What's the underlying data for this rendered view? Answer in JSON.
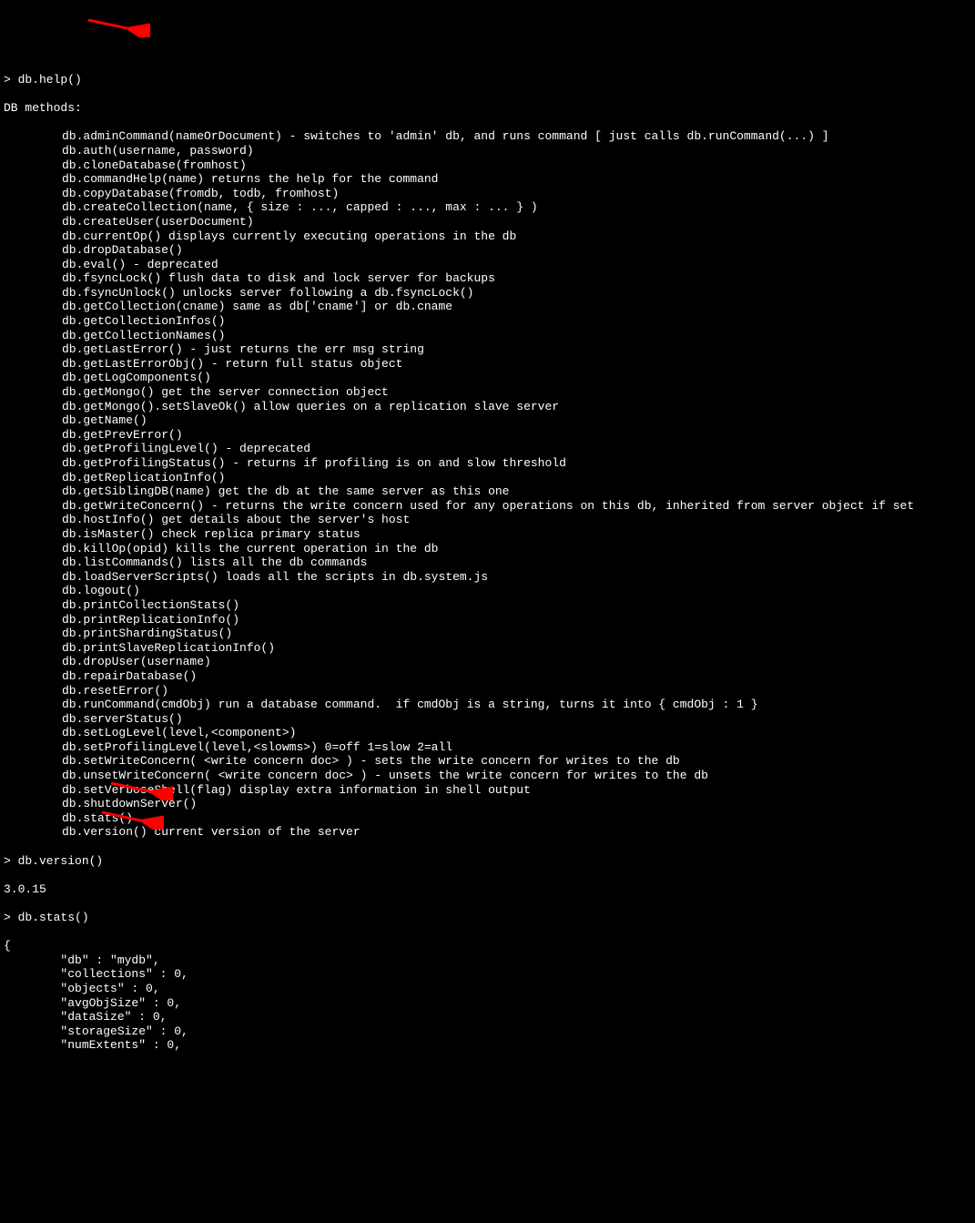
{
  "prompts": {
    "help": "> db.help()",
    "version": "> db.version()",
    "stats": "> db.stats()"
  },
  "header": "DB methods:",
  "methods": [
    "db.adminCommand(nameOrDocument) - switches to 'admin' db, and runs command [ just calls db.runCommand(...) ]",
    "db.auth(username, password)",
    "db.cloneDatabase(fromhost)",
    "db.commandHelp(name) returns the help for the command",
    "db.copyDatabase(fromdb, todb, fromhost)",
    "db.createCollection(name, { size : ..., capped : ..., max : ... } )",
    "db.createUser(userDocument)",
    "db.currentOp() displays currently executing operations in the db",
    "db.dropDatabase()",
    "db.eval() - deprecated",
    "db.fsyncLock() flush data to disk and lock server for backups",
    "db.fsyncUnlock() unlocks server following a db.fsyncLock()",
    "db.getCollection(cname) same as db['cname'] or db.cname",
    "db.getCollectionInfos()",
    "db.getCollectionNames()",
    "db.getLastError() - just returns the err msg string",
    "db.getLastErrorObj() - return full status object",
    "db.getLogComponents()",
    "db.getMongo() get the server connection object",
    "db.getMongo().setSlaveOk() allow queries on a replication slave server",
    "db.getName()",
    "db.getPrevError()",
    "db.getProfilingLevel() - deprecated",
    "db.getProfilingStatus() - returns if profiling is on and slow threshold",
    "db.getReplicationInfo()",
    "db.getSiblingDB(name) get the db at the same server as this one",
    "db.getWriteConcern() - returns the write concern used for any operations on this db, inherited from server object if set",
    "db.hostInfo() get details about the server's host",
    "db.isMaster() check replica primary status",
    "db.killOp(opid) kills the current operation in the db",
    "db.listCommands() lists all the db commands",
    "db.loadServerScripts() loads all the scripts in db.system.js",
    "db.logout()",
    "db.printCollectionStats()",
    "db.printReplicationInfo()",
    "db.printShardingStatus()",
    "db.printSlaveReplicationInfo()",
    "db.dropUser(username)",
    "db.repairDatabase()",
    "db.resetError()",
    "db.runCommand(cmdObj) run a database command.  if cmdObj is a string, turns it into { cmdObj : 1 }",
    "db.serverStatus()",
    "db.setLogLevel(level,<component>)",
    "db.setProfilingLevel(level,<slowms>) 0=off 1=slow 2=all",
    "db.setWriteConcern( <write concern doc> ) - sets the write concern for writes to the db",
    "db.unsetWriteConcern( <write concern doc> ) - unsets the write concern for writes to the db",
    "db.setVerboseShell(flag) display extra information in shell output",
    "db.shutdownServer()",
    "db.stats()",
    "db.version() current version of the server"
  ],
  "version_output": "3.0.15",
  "stats_output": [
    "{",
    "        \"db\" : \"mydb\",",
    "        \"collections\" : 0,",
    "        \"objects\" : 0,",
    "        \"avgObjSize\" : 0,",
    "        \"dataSize\" : 0,",
    "        \"storageSize\" : 0,",
    "        \"numExtents\" : 0,"
  ],
  "arrows": {
    "color": "#ff0000"
  }
}
